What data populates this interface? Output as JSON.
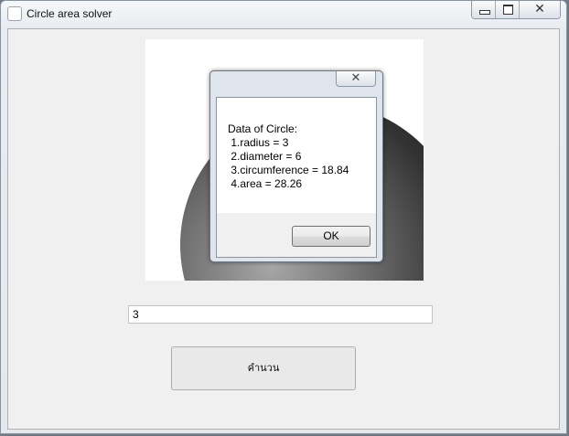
{
  "window": {
    "title": "Circle area solver",
    "controls": {
      "minimize": "minimize-icon",
      "maximize": "maximize-icon",
      "close": "close-icon",
      "close_glyph": "✕"
    }
  },
  "dialog": {
    "close_glyph": "✕",
    "message_lines": [
      "Data of Circle:",
      " 1.radius = 3",
      " 2.diameter = 6",
      " 3.circumference = 18.84",
      " 4.area = 28.26"
    ],
    "ok_label": "OK"
  },
  "form": {
    "radius_value": "3",
    "calculate_label": "คำนวน"
  }
}
